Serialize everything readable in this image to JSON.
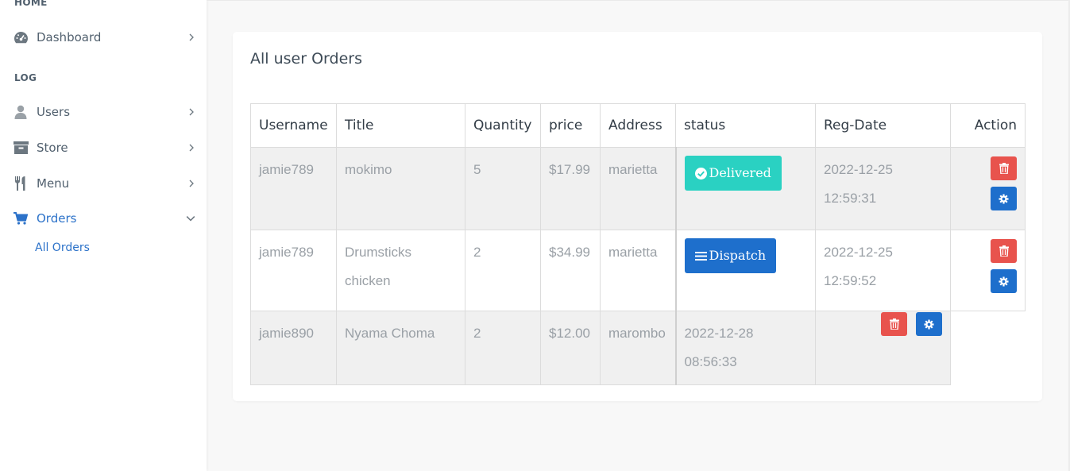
{
  "sidebar": {
    "section_home": "HOME",
    "section_log": "LOG",
    "items": [
      {
        "label": "Dashboard",
        "icon": "dashboard-icon"
      },
      {
        "label": "Users",
        "icon": "user-icon"
      },
      {
        "label": "Store",
        "icon": "archive-icon"
      },
      {
        "label": "Menu",
        "icon": "utensils-icon"
      },
      {
        "label": "Orders",
        "icon": "cart-icon"
      }
    ],
    "sub_item": "All Orders"
  },
  "card": {
    "title": "All user Orders"
  },
  "table": {
    "headers": [
      "Username",
      "Title",
      "Quantity",
      "price",
      "Address",
      "status",
      "Reg-Date",
      "Action"
    ],
    "rows": [
      {
        "username": "jamie789",
        "title": "mokimo",
        "quantity": "5",
        "price": "$17.99",
        "address": "marietta",
        "status": "Delivered",
        "date": "2022-12-25",
        "time": "12:59:31"
      },
      {
        "username": "jamie789",
        "title_line1": "Drumsticks",
        "title_line2": "chicken",
        "quantity": "2",
        "price": "$34.99",
        "address": "marietta",
        "status": "Dispatch",
        "date": "2022-12-25",
        "time": "12:59:52"
      },
      {
        "username": "jamie890",
        "title": "Nyama Choma",
        "quantity": "2",
        "price": "$12.00",
        "address": "marombo",
        "date": "2022-12-28",
        "time": "08:56:33"
      }
    ]
  },
  "colors": {
    "accent": "#2c72c9",
    "delivered": "#2ad1c2",
    "dispatch": "#1e6fcc",
    "delete": "#e8534d"
  }
}
